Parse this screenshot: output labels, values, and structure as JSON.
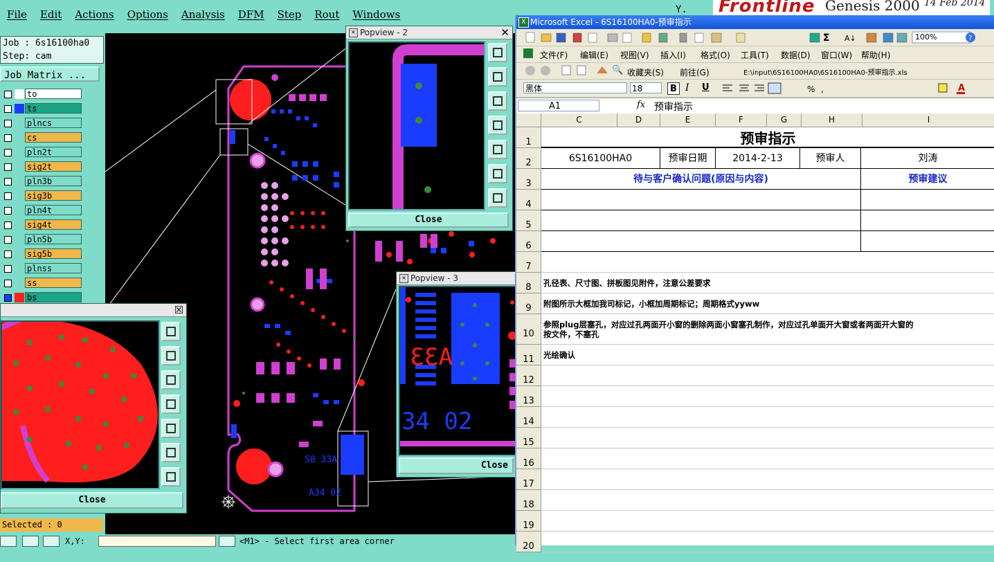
{
  "genesis": {
    "menu": [
      "File",
      "Edit",
      "Actions",
      "Options",
      "Analysis",
      "DFM",
      "Step",
      "Rout",
      "Windows"
    ],
    "misc_label": "Y.",
    "brand": "Frontline",
    "product": "Genesis 2000",
    "date": "14 Feb 2014",
    "job_label": "Job : 6s16100ha0",
    "step_label": "Step: cam",
    "job_matrix_button": "Job Matrix ...",
    "layers": [
      {
        "name": "to",
        "color": "#ffffff",
        "swatch": "#ffffff",
        "checked": false
      },
      {
        "name": "ts",
        "color": "#1aa586",
        "swatch": "#1a3cff",
        "checked": false
      },
      {
        "name": "plncs",
        "color": "#7fdcc8",
        "swatch": "#7fdcc8",
        "checked": false
      },
      {
        "name": "cs",
        "color": "#f0b74a",
        "swatch": "#7fdcc8",
        "checked": false
      },
      {
        "name": "pln2t",
        "color": "#7fdcc8",
        "swatch": "#7fdcc8",
        "checked": false
      },
      {
        "name": "sig2t",
        "color": "#f0b74a",
        "swatch": "#7fdcc8",
        "checked": false
      },
      {
        "name": "pln3b",
        "color": "#7fdcc8",
        "swatch": "#7fdcc8",
        "checked": false
      },
      {
        "name": "sig3b",
        "color": "#f0b74a",
        "swatch": "#7fdcc8",
        "checked": false
      },
      {
        "name": "pln4t",
        "color": "#7fdcc8",
        "swatch": "#7fdcc8",
        "checked": false
      },
      {
        "name": "sig4t",
        "color": "#f0b74a",
        "swatch": "#7fdcc8",
        "checked": false
      },
      {
        "name": "pln5b",
        "color": "#7fdcc8",
        "swatch": "#7fdcc8",
        "checked": false
      },
      {
        "name": "sig5b",
        "color": "#f0b74a",
        "swatch": "#7fdcc8",
        "checked": false
      },
      {
        "name": "plnss",
        "color": "#7fdcc8",
        "swatch": "#7fdcc8",
        "checked": false
      },
      {
        "name": "ss",
        "color": "#f0b74a",
        "swatch": "#7fdcc8",
        "checked": false
      },
      {
        "name": "bs",
        "color": "#1aa586",
        "swatch": "#ff2020",
        "checked": true
      }
    ],
    "selected_label": "Selected : 0",
    "xy_label": "X,Y:",
    "status_message": "<M1> - Select first area corner",
    "popview_main": {
      "close": "Close"
    },
    "popview2": {
      "title": "Popview - 2",
      "close": "Close"
    },
    "popview3": {
      "title": "Popview - 3",
      "close": "Close",
      "silk_a": "A33",
      "silk_b": "34 02"
    },
    "canvas_silk": [
      "A34 02",
      "S0 33A"
    ]
  },
  "excel": {
    "title": "Microsoft Excel - 6S16100HA0-预审指示",
    "menu": [
      "文件(F)",
      "编辑(E)",
      "视图(V)",
      "插入(I)",
      "格式(O)",
      "工具(T)",
      "数据(D)",
      "窗口(W)",
      "帮助(H)"
    ],
    "zoom": "100%",
    "favorites": "收藏夹(S)",
    "goto": "前往(G)",
    "path": "E:\\input\\6S16100HA0\\6S16100HA0-预审指示.xls",
    "font": "黑体",
    "font_size": "18",
    "name_box": "A1",
    "fx": "fx",
    "formula": "预审指示",
    "columns": [
      "C",
      "D",
      "E",
      "F",
      "G",
      "H",
      "I"
    ],
    "rows": [
      "1",
      "2",
      "3",
      "4",
      "5",
      "6",
      "7",
      "8",
      "9",
      "10",
      "11",
      "12",
      "13",
      "14",
      "15",
      "16",
      "17",
      "18",
      "19",
      "20"
    ],
    "sheet": {
      "title": "预审指示",
      "job": "6S16100HA0",
      "date_label": "预审日期",
      "date": "2014-2-13",
      "reviewer_label": "预审人",
      "reviewer": "刘涛",
      "issues_header": "待与客户确认问题(原因与内容)",
      "suggestion_header": "预审建议",
      "note8": "孔径表、尺寸图、拼板图见附件，注意公差要求",
      "note9": "附图所示大框加我司标记，小框加周期标记；周期格式yyww",
      "note10a": "参照plug层塞孔，对应过孔两面开小窗的删除两面小窗塞孔制作，对应过孔单面开大窗或者两面开大窗的",
      "note10b": "按文件，不塞孔",
      "note11": "光绘确认"
    }
  }
}
